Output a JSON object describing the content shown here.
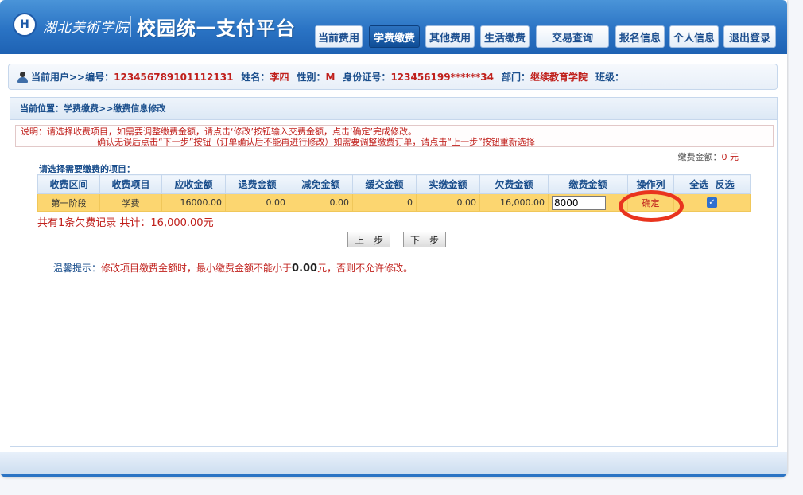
{
  "header": {
    "logo_text": "H",
    "school_name": "湖北美術学院",
    "platform_title": "校园统一支付平台"
  },
  "nav": [
    "当前费用",
    "学费缴费",
    "其他费用",
    "生活缴费",
    "交易查询",
    "报名信息",
    "个人信息",
    "退出登录"
  ],
  "active_nav": "学费缴费",
  "user": {
    "prefix": "当前用户>>编号：",
    "id": "123456789101112131",
    "name_label": "姓名：",
    "name": "李四",
    "gender_label": "性别：",
    "gender": "M",
    "idcard_label": "身份证号：",
    "idcard": "123456199******34",
    "dept_label": "部门：",
    "dept": "继续教育学院",
    "class_label": "班级："
  },
  "breadcrumb": "当前位置：学费缴费>>缴费信息修改",
  "note": {
    "line1": "说明：请选择收费项目，如需要调整缴费金额，请点击‘修改’按钮输入交费金额，点击‘确定’完成修改。",
    "line2": "确认无误后点击“下一步”按钮（订单确认后不能再进行修改）如需要调整缴费订单，请点击“上一步”按钮重新选择"
  },
  "pay_total_label": "缴费金额：",
  "pay_total_value": "0 元",
  "choose_label": "请选择需要缴费的项目：",
  "table": {
    "headers": [
      "收费区间",
      "收费项目",
      "应收金额",
      "退费金额",
      "减免金额",
      "缓交金额",
      "实缴金额",
      "欠费金额",
      "缴费金额",
      "操作列",
      "全选",
      "反选"
    ],
    "row": {
      "interval": "第一阶段",
      "item": "学费",
      "due": "16000.00",
      "refund": "0.00",
      "reduction": "0.00",
      "deferred": "0",
      "paid": "0.00",
      "owed": "16,000.00",
      "payment_input": "8000",
      "action": "确定",
      "selected_mark": "✓"
    }
  },
  "summary": "共有1条欠费记录 共计：16,000.00元",
  "buttons": {
    "prev": "上一步",
    "next": "下一步"
  },
  "tip": {
    "label": "温馨提示：",
    "text_before": "修改项目缴费金额时，最小缴费金额不能小于",
    "amount": "0.00",
    "text_after": "元，否则不允许修改。"
  },
  "colors": {
    "header_blue": "#2a73c4",
    "highlight_red": "#c0201c",
    "row_yellow": "#fcd670",
    "annotation_circle": "#e9341e"
  }
}
